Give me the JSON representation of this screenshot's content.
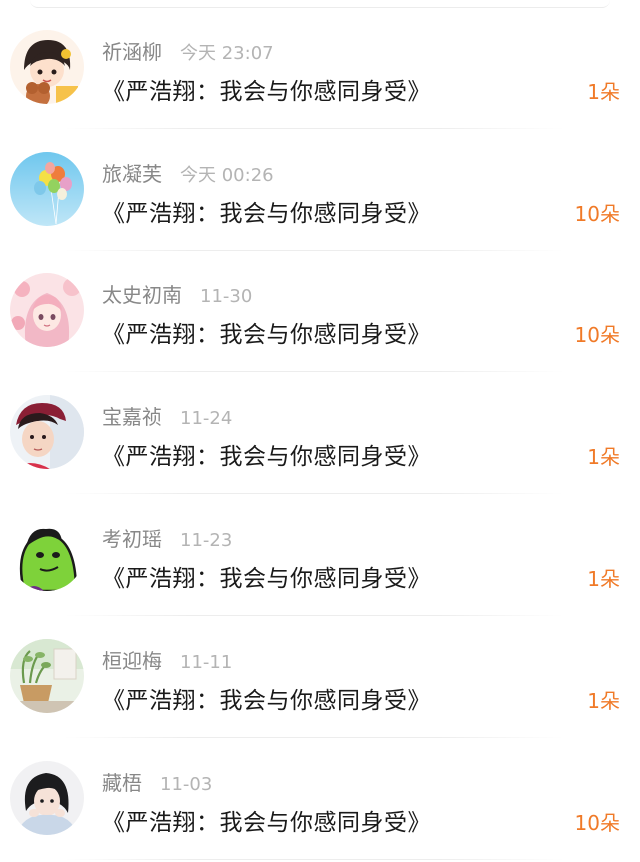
{
  "gifts": [
    {
      "name": "祈涵柳",
      "time": "今天 23:07",
      "title": "《严浩翔：我会与你感同身受》",
      "count": "1朵"
    },
    {
      "name": "旅凝芙",
      "time": "今天 00:26",
      "title": "《严浩翔：我会与你感同身受》",
      "count": "10朵"
    },
    {
      "name": "太史初南",
      "time": "11-30",
      "title": "《严浩翔：我会与你感同身受》",
      "count": "10朵"
    },
    {
      "name": "宝嘉祯",
      "time": "11-24",
      "title": "《严浩翔：我会与你感同身受》",
      "count": "1朵"
    },
    {
      "name": "考初瑶",
      "time": "11-23",
      "title": "《严浩翔：我会与你感同身受》",
      "count": "1朵"
    },
    {
      "name": "桓迎梅",
      "time": "11-11",
      "title": "《严浩翔：我会与你感同身受》",
      "count": "1朵"
    },
    {
      "name": "藏梧",
      "time": "11-03",
      "title": "《严浩翔：我会与你感同身受》",
      "count": "10朵"
    }
  ],
  "colors": {
    "accent": "#f07a28",
    "name": "#888888",
    "time": "#b4b4b4",
    "title": "#1a1a1a"
  },
  "icons": [
    "cartoon-girl-avatar",
    "balloons-avatar",
    "anime-girl-avatar",
    "boy-portrait-avatar",
    "green-monster-avatar",
    "plant-photo-avatar",
    "girl-photo-avatar"
  ]
}
